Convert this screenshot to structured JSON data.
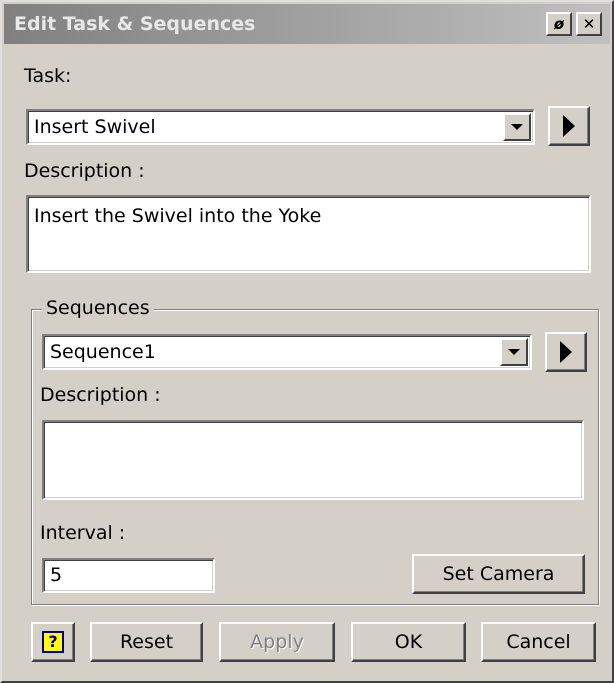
{
  "window": {
    "title": "Edit Task & Sequences",
    "pin_glyph": "ø",
    "close_glyph": "✕"
  },
  "task": {
    "label": "Task:",
    "selected": "Insert Swivel",
    "description_label": "Description :",
    "description": "Insert the Swivel into the Yoke"
  },
  "sequences": {
    "group_label": "Sequences",
    "selected": "Sequence1",
    "description_label": "Description :",
    "description": "",
    "interval_label": "Interval :",
    "interval_value": "5",
    "set_camera_label": "Set Camera"
  },
  "buttons": {
    "help_glyph": "?",
    "reset_label": "Reset",
    "apply_label": "Apply",
    "ok_label": "OK",
    "cancel_label": "Cancel"
  },
  "icons": {
    "pin": "pin-icon",
    "close": "close-icon",
    "dropdown": "chevron-down-icon",
    "play": "play-icon",
    "help": "help-icon"
  },
  "colors": {
    "dialog_bg": "#d4d0c8",
    "title_gradient_start": "#808080",
    "title_gradient_end": "#c0c0c0",
    "help_icon_bg": "#ffff00",
    "help_icon_fg": "#000080"
  }
}
